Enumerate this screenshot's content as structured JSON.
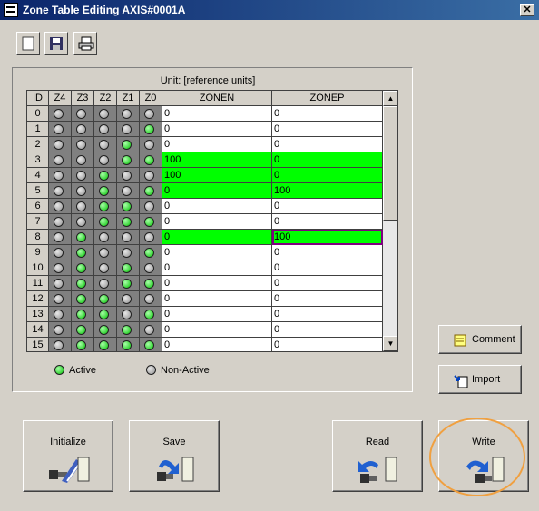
{
  "window": {
    "title": "Zone Table Editing AXIS#0001A",
    "close_label": "✕"
  },
  "toolbar": {
    "new_icon": "blank-page-icon",
    "save_icon": "floppy-disk-icon",
    "print_icon": "printer-icon"
  },
  "table": {
    "unit_label": "Unit:  [reference units]",
    "headers": [
      "ID",
      "Z4",
      "Z3",
      "Z2",
      "Z1",
      "Z0",
      "ZONEN",
      "ZONEP"
    ],
    "rows": [
      {
        "id": "0",
        "z": [
          0,
          0,
          0,
          0,
          0
        ],
        "zonen": "0",
        "zonep": "0",
        "highlight": false
      },
      {
        "id": "1",
        "z": [
          0,
          0,
          0,
          0,
          1
        ],
        "zonen": "0",
        "zonep": "0",
        "highlight": false
      },
      {
        "id": "2",
        "z": [
          0,
          0,
          0,
          1,
          0
        ],
        "zonen": "0",
        "zonep": "0",
        "highlight": false
      },
      {
        "id": "3",
        "z": [
          0,
          0,
          0,
          1,
          1
        ],
        "zonen": "100",
        "zonep": "0",
        "highlight": true
      },
      {
        "id": "4",
        "z": [
          0,
          0,
          1,
          0,
          0
        ],
        "zonen": "100",
        "zonep": "0",
        "highlight": true
      },
      {
        "id": "5",
        "z": [
          0,
          0,
          1,
          0,
          1
        ],
        "zonen": "0",
        "zonep": "100",
        "highlight": true
      },
      {
        "id": "6",
        "z": [
          0,
          0,
          1,
          1,
          0
        ],
        "zonen": "0",
        "zonep": "0",
        "highlight": false
      },
      {
        "id": "7",
        "z": [
          0,
          0,
          1,
          1,
          1
        ],
        "zonen": "0",
        "zonep": "0",
        "highlight": false
      },
      {
        "id": "8",
        "z": [
          0,
          1,
          0,
          0,
          0
        ],
        "zonen": "0",
        "zonep": "100",
        "highlight": true
      },
      {
        "id": "9",
        "z": [
          0,
          1,
          0,
          0,
          1
        ],
        "zonen": "0",
        "zonep": "0",
        "highlight": false
      },
      {
        "id": "10",
        "z": [
          0,
          1,
          0,
          1,
          0
        ],
        "zonen": "0",
        "zonep": "0",
        "highlight": false
      },
      {
        "id": "11",
        "z": [
          0,
          1,
          0,
          1,
          1
        ],
        "zonen": "0",
        "zonep": "0",
        "highlight": false
      },
      {
        "id": "12",
        "z": [
          0,
          1,
          1,
          0,
          0
        ],
        "zonen": "0",
        "zonep": "0",
        "highlight": false
      },
      {
        "id": "13",
        "z": [
          0,
          1,
          1,
          0,
          1
        ],
        "zonen": "0",
        "zonep": "0",
        "highlight": false
      },
      {
        "id": "14",
        "z": [
          0,
          1,
          1,
          1,
          0
        ],
        "zonen": "0",
        "zonep": "0",
        "highlight": false
      },
      {
        "id": "15",
        "z": [
          0,
          1,
          1,
          1,
          1
        ],
        "zonen": "0",
        "zonep": "0",
        "highlight": false
      }
    ],
    "selected_row": "8",
    "selected_column": "ZONEP"
  },
  "legend": {
    "active": "Active",
    "inactive": "Non-Active"
  },
  "side_buttons": {
    "comment": "Comment",
    "import": "Import"
  },
  "bottom_buttons": {
    "initialize": "Initialize",
    "save": "Save",
    "read": "Read",
    "write": "Write"
  },
  "colors": {
    "active_led": "#00c000",
    "highlight_row": "#00ff00",
    "focus_ring": "#f0a040",
    "selection_border": "#800080"
  }
}
